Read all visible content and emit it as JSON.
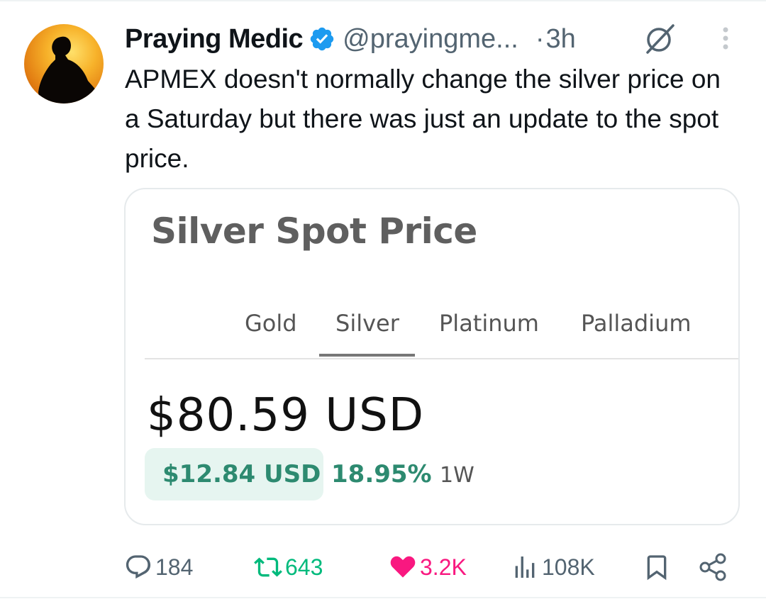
{
  "author": {
    "display_name": "Praying Medic",
    "handle": "@prayingme...",
    "time_sep": "·",
    "time": "3h"
  },
  "tweet": {
    "text": "APMEX doesn't normally change the silver price on a Saturday but there was just an update to the spot price."
  },
  "card": {
    "title": "Silver Spot Price",
    "tabs": [
      "Gold",
      "Silver",
      "Platinum",
      "Palladium"
    ],
    "selected_tab": "Silver",
    "price": "$80.59 USD",
    "change_amount": "$12.84 USD",
    "change_pct": "18.95%",
    "period": "1W"
  },
  "actions": {
    "replies": "184",
    "reposts": "643",
    "likes": "3.2K",
    "views": "108K"
  },
  "icons": {
    "verified": "verified-badge-icon",
    "grok": "grok-icon",
    "more": "more-vertical-icon",
    "reply": "reply-icon",
    "repost": "repost-icon",
    "like": "heart-icon",
    "views": "views-icon",
    "bookmark": "bookmark-icon",
    "share": "share-icon"
  },
  "colors": {
    "verified": "#1d9bf0",
    "repost": "#00ba7c",
    "like": "#f91880",
    "muted": "#536471",
    "change_green": "#2d8a70",
    "change_badge_bg": "#e6f5f0"
  }
}
